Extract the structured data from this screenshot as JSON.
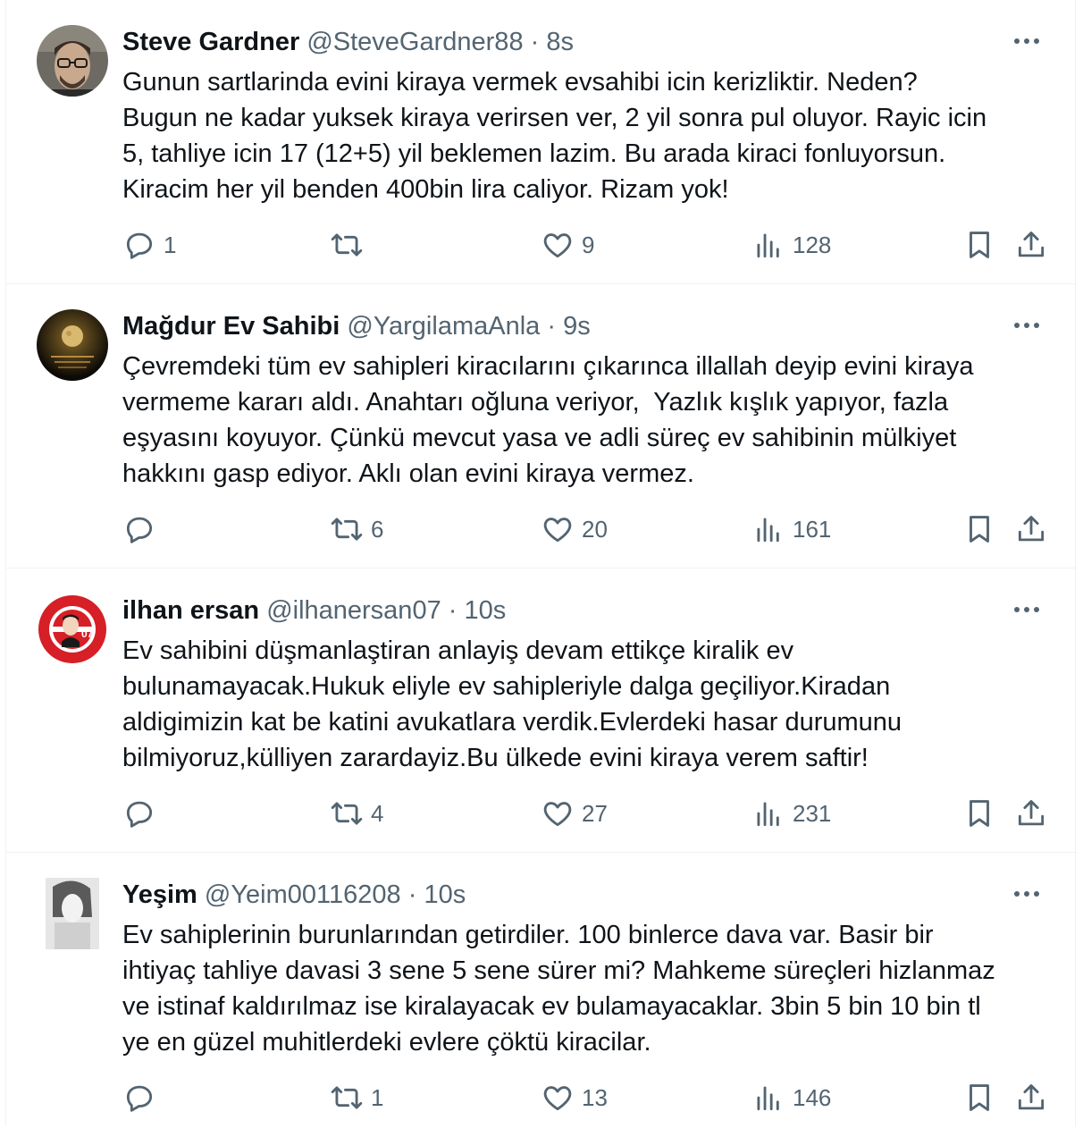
{
  "colors": {
    "text": "#0f1419",
    "muted": "#536471",
    "divider": "#eff3f4"
  },
  "tweets": [
    {
      "name": "Steve Gardner",
      "handle": "@SteveGardner88",
      "time": "8s",
      "text": "Gunun sartlarinda evini kiraya vermek evsahibi icin kerizliktir. Neden?\nBugun ne kadar yuksek kiraya verirsen ver, 2 yil sonra pul oluyor. Rayic icin\n5, tahliye icin 17 (12+5) yil beklemen lazim. Bu arada kiraci fonluyorsun.\nKiracim her yil benden 400bin lira caliyor. Rizam yok!",
      "replies": "1",
      "retweets": "",
      "likes": "9",
      "views": "128"
    },
    {
      "name": "Mağdur Ev Sahibi",
      "handle": "@YargilamaAnla",
      "time": "9s",
      "text": "Çevremdeki tüm ev sahipleri kiracılarını çıkarınca illallah deyip evini kiraya\nvermeme kararı aldı. Anahtarı oğluna veriyor,  Yazlık kışlık yapıyor, fazla\neşyasını koyuyor. Çünkü mevcut yasa ve adli süreç ev sahibinin mülkiyet\nhakkını gasp ediyor. Aklı olan evini kiraya vermez.",
      "replies": "",
      "retweets": "6",
      "likes": "20",
      "views": "161"
    },
    {
      "name": "ilhan ersan",
      "handle": "@ilhanersan07",
      "time": "10s",
      "text": "Ev sahibini düşmanlaştiran anlayiş devam ettikçe kiralik ev\nbulunamayacak.Hukuk eliyle ev sahipleriyle dalga geçiliyor.Kiradan\naldigimizin kat be katini avukatlara verdik.Evlerdeki hasar durumunu\nbilmiyoruz,külliyen zarardayiz.Bu ülkede evini kiraya verem saftir!",
      "replies": "",
      "retweets": "4",
      "likes": "27",
      "views": "231"
    },
    {
      "name": "Yeşim",
      "handle": "@Yeim00116208",
      "time": "10s",
      "text": "Ev sahiplerinin burunlarından getirdiler. 100 binlerce dava var. Basir bir\nihtiyaç tahliye davasi 3 sene 5 sene sürer mi? Mahkeme süreçleri hizlanmaz\nve istinaf kaldırılmaz ise kiralayacak ev bulamayacaklar. 3bin 5 bin 10 bin tl\nye en güzel muhitlerdeki evlere çöktü kiracilar.",
      "replies": "",
      "retweets": "1",
      "likes": "13",
      "views": "146"
    }
  ],
  "avatar_logo": {
    "text": "ANTALYASPOR",
    "number": "07"
  },
  "icons": [
    "more-icon",
    "reply-icon",
    "retweet-icon",
    "like-icon",
    "views-icon",
    "bookmark-icon",
    "share-icon"
  ]
}
